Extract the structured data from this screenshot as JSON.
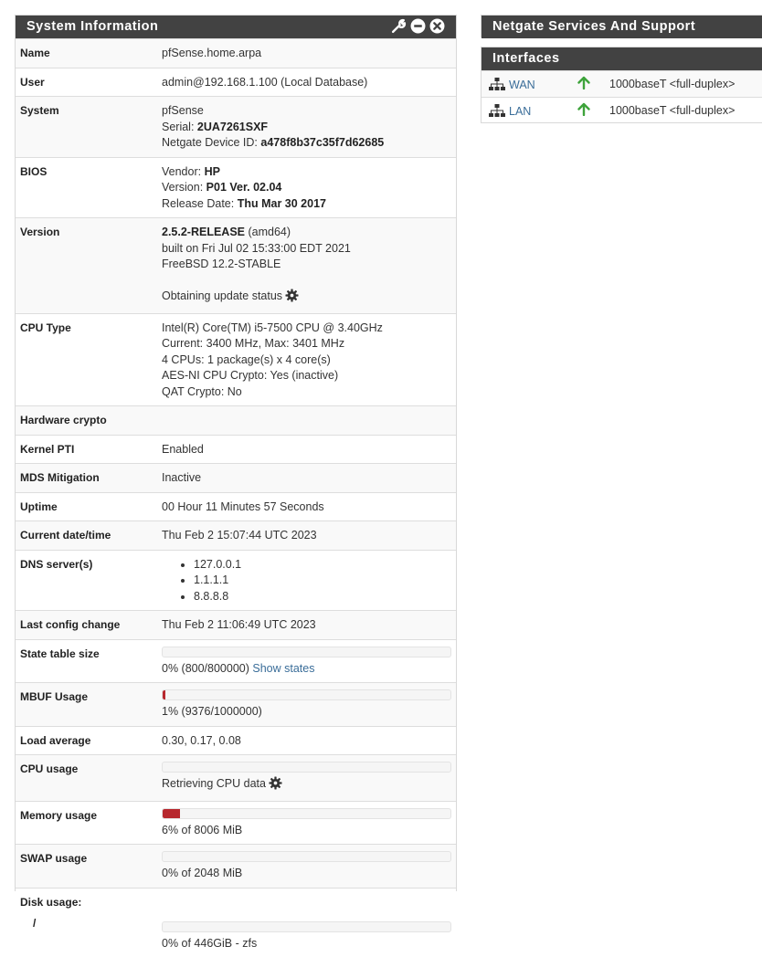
{
  "sysinfo": {
    "title": "System Information",
    "name_label": "Name",
    "name_value": "pfSense.home.arpa",
    "user_label": "User",
    "user_value": "admin@192.168.1.100 (Local Database)",
    "system_label": "System",
    "system_product": "pfSense",
    "serial_label": "Serial:",
    "serial_value": "2UA7261SXF",
    "device_id_label": "Netgate Device ID:",
    "device_id_value": "a478f8b37c35f7d62685",
    "bios_label": "BIOS",
    "bios_vendor_label": "Vendor:",
    "bios_vendor": "HP",
    "bios_version_label": "Version:",
    "bios_version": "P01 Ver. 02.04",
    "bios_date_label": "Release Date:",
    "bios_date": "Thu Mar 30 2017",
    "version_label": "Version",
    "version_release": "2.5.2-RELEASE",
    "version_arch": "(amd64)",
    "version_built": "built on Fri Jul 02 15:33:00 EDT 2021",
    "version_os": "FreeBSD 12.2-STABLE",
    "update_status": "Obtaining update status",
    "cpu_type_label": "CPU Type",
    "cpu_model": "Intel(R) Core(TM) i5-7500 CPU @ 3.40GHz",
    "cpu_freq": "Current: 3400 MHz, Max: 3401 MHz",
    "cpu_count": "4 CPUs: 1 package(s) x 4 core(s)",
    "cpu_aesni": "AES-NI CPU Crypto: Yes (inactive)",
    "cpu_qat": "QAT Crypto: No",
    "hw_crypto_label": "Hardware crypto",
    "hw_crypto_value": "",
    "kernel_pti_label": "Kernel PTI",
    "kernel_pti_value": "Enabled",
    "mds_label": "MDS Mitigation",
    "mds_value": "Inactive",
    "uptime_label": "Uptime",
    "uptime_value": "00 Hour 11 Minutes 57 Seconds",
    "datetime_label": "Current date/time",
    "datetime_value": "Thu Feb 2 15:07:44 UTC 2023",
    "dns_label": "DNS server(s)",
    "dns_servers": [
      "127.0.0.1",
      "1.1.1.1",
      "8.8.8.8"
    ],
    "last_config_label": "Last config change",
    "last_config_value": "Thu Feb 2 11:06:49 UTC 2023",
    "state_table_label": "State table size",
    "state_table_value": "0% (800/800000)",
    "state_table_pct": 0,
    "show_states_link": "Show states",
    "mbuf_label": "MBUF Usage",
    "mbuf_value": "1% (9376/1000000)",
    "mbuf_pct": 1,
    "load_label": "Load average",
    "load_value": "0.30, 0.17, 0.08",
    "cpu_usage_label": "CPU usage",
    "cpu_usage_value": "Retrieving CPU data",
    "cpu_usage_pct": 0,
    "memory_label": "Memory usage",
    "memory_value": "6% of 8006 MiB",
    "memory_pct": 6,
    "swap_label": "SWAP usage",
    "swap_value": "0% of 2048 MiB",
    "swap_pct": 0,
    "disk_label": "Disk usage:",
    "disk_mount": "/",
    "disk_value": "0% of 446GiB - zfs",
    "disk_pct": 0
  },
  "netgate": {
    "title": "Netgate Services And Support"
  },
  "interfaces": {
    "title": "Interfaces",
    "items": [
      {
        "name": "WAN",
        "media": "1000baseT <full-duplex>",
        "status": "up"
      },
      {
        "name": "LAN",
        "media": "1000baseT <full-duplex>",
        "status": "up"
      }
    ]
  },
  "colors": {
    "header_bg": "#424242",
    "bar_fill": "#b7282e",
    "status_up": "#3ea33b",
    "link": "#3a6d99"
  },
  "icons": [
    "wrench-icon",
    "minus-circle-icon",
    "close-circle-icon",
    "gear-icon",
    "network-icon",
    "arrow-up-icon"
  ]
}
